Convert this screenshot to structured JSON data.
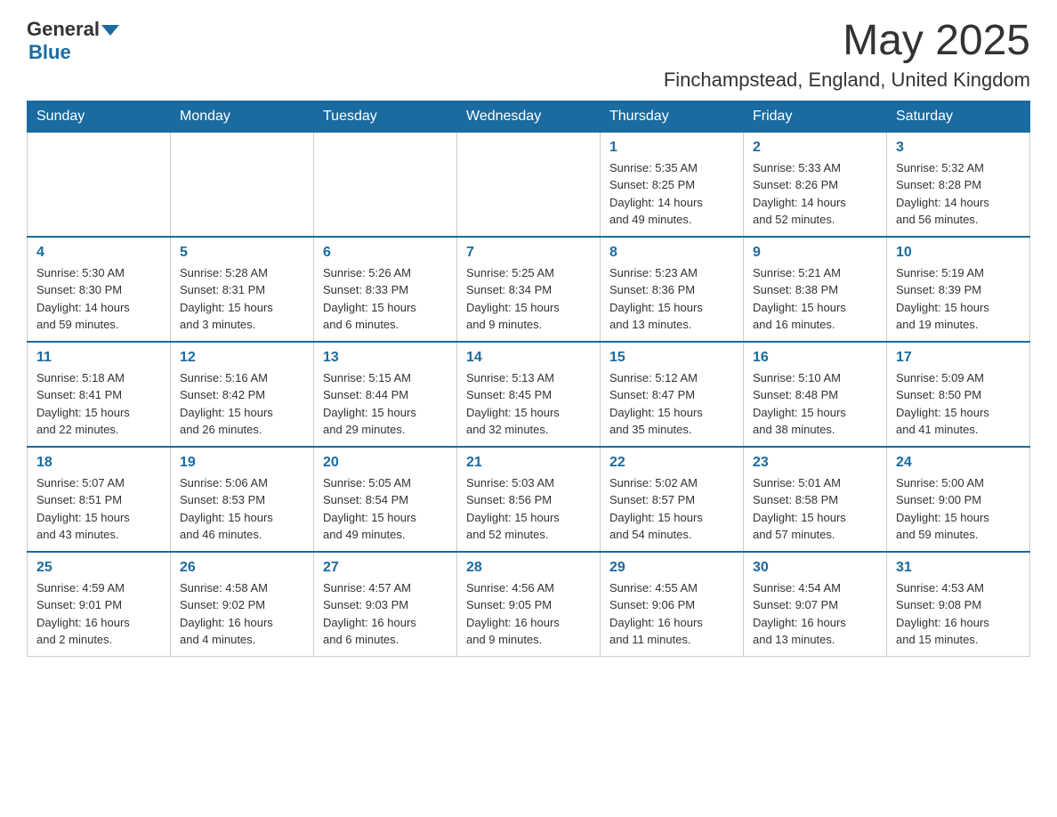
{
  "header": {
    "logo_general": "General",
    "logo_blue": "Blue",
    "month_title": "May 2025",
    "location": "Finchampstead, England, United Kingdom"
  },
  "days_of_week": [
    "Sunday",
    "Monday",
    "Tuesday",
    "Wednesday",
    "Thursday",
    "Friday",
    "Saturday"
  ],
  "weeks": [
    {
      "days": [
        {
          "num": "",
          "info": ""
        },
        {
          "num": "",
          "info": ""
        },
        {
          "num": "",
          "info": ""
        },
        {
          "num": "",
          "info": ""
        },
        {
          "num": "1",
          "info": "Sunrise: 5:35 AM\nSunset: 8:25 PM\nDaylight: 14 hours\nand 49 minutes."
        },
        {
          "num": "2",
          "info": "Sunrise: 5:33 AM\nSunset: 8:26 PM\nDaylight: 14 hours\nand 52 minutes."
        },
        {
          "num": "3",
          "info": "Sunrise: 5:32 AM\nSunset: 8:28 PM\nDaylight: 14 hours\nand 56 minutes."
        }
      ]
    },
    {
      "days": [
        {
          "num": "4",
          "info": "Sunrise: 5:30 AM\nSunset: 8:30 PM\nDaylight: 14 hours\nand 59 minutes."
        },
        {
          "num": "5",
          "info": "Sunrise: 5:28 AM\nSunset: 8:31 PM\nDaylight: 15 hours\nand 3 minutes."
        },
        {
          "num": "6",
          "info": "Sunrise: 5:26 AM\nSunset: 8:33 PM\nDaylight: 15 hours\nand 6 minutes."
        },
        {
          "num": "7",
          "info": "Sunrise: 5:25 AM\nSunset: 8:34 PM\nDaylight: 15 hours\nand 9 minutes."
        },
        {
          "num": "8",
          "info": "Sunrise: 5:23 AM\nSunset: 8:36 PM\nDaylight: 15 hours\nand 13 minutes."
        },
        {
          "num": "9",
          "info": "Sunrise: 5:21 AM\nSunset: 8:38 PM\nDaylight: 15 hours\nand 16 minutes."
        },
        {
          "num": "10",
          "info": "Sunrise: 5:19 AM\nSunset: 8:39 PM\nDaylight: 15 hours\nand 19 minutes."
        }
      ]
    },
    {
      "days": [
        {
          "num": "11",
          "info": "Sunrise: 5:18 AM\nSunset: 8:41 PM\nDaylight: 15 hours\nand 22 minutes."
        },
        {
          "num": "12",
          "info": "Sunrise: 5:16 AM\nSunset: 8:42 PM\nDaylight: 15 hours\nand 26 minutes."
        },
        {
          "num": "13",
          "info": "Sunrise: 5:15 AM\nSunset: 8:44 PM\nDaylight: 15 hours\nand 29 minutes."
        },
        {
          "num": "14",
          "info": "Sunrise: 5:13 AM\nSunset: 8:45 PM\nDaylight: 15 hours\nand 32 minutes."
        },
        {
          "num": "15",
          "info": "Sunrise: 5:12 AM\nSunset: 8:47 PM\nDaylight: 15 hours\nand 35 minutes."
        },
        {
          "num": "16",
          "info": "Sunrise: 5:10 AM\nSunset: 8:48 PM\nDaylight: 15 hours\nand 38 minutes."
        },
        {
          "num": "17",
          "info": "Sunrise: 5:09 AM\nSunset: 8:50 PM\nDaylight: 15 hours\nand 41 minutes."
        }
      ]
    },
    {
      "days": [
        {
          "num": "18",
          "info": "Sunrise: 5:07 AM\nSunset: 8:51 PM\nDaylight: 15 hours\nand 43 minutes."
        },
        {
          "num": "19",
          "info": "Sunrise: 5:06 AM\nSunset: 8:53 PM\nDaylight: 15 hours\nand 46 minutes."
        },
        {
          "num": "20",
          "info": "Sunrise: 5:05 AM\nSunset: 8:54 PM\nDaylight: 15 hours\nand 49 minutes."
        },
        {
          "num": "21",
          "info": "Sunrise: 5:03 AM\nSunset: 8:56 PM\nDaylight: 15 hours\nand 52 minutes."
        },
        {
          "num": "22",
          "info": "Sunrise: 5:02 AM\nSunset: 8:57 PM\nDaylight: 15 hours\nand 54 minutes."
        },
        {
          "num": "23",
          "info": "Sunrise: 5:01 AM\nSunset: 8:58 PM\nDaylight: 15 hours\nand 57 minutes."
        },
        {
          "num": "24",
          "info": "Sunrise: 5:00 AM\nSunset: 9:00 PM\nDaylight: 15 hours\nand 59 minutes."
        }
      ]
    },
    {
      "days": [
        {
          "num": "25",
          "info": "Sunrise: 4:59 AM\nSunset: 9:01 PM\nDaylight: 16 hours\nand 2 minutes."
        },
        {
          "num": "26",
          "info": "Sunrise: 4:58 AM\nSunset: 9:02 PM\nDaylight: 16 hours\nand 4 minutes."
        },
        {
          "num": "27",
          "info": "Sunrise: 4:57 AM\nSunset: 9:03 PM\nDaylight: 16 hours\nand 6 minutes."
        },
        {
          "num": "28",
          "info": "Sunrise: 4:56 AM\nSunset: 9:05 PM\nDaylight: 16 hours\nand 9 minutes."
        },
        {
          "num": "29",
          "info": "Sunrise: 4:55 AM\nSunset: 9:06 PM\nDaylight: 16 hours\nand 11 minutes."
        },
        {
          "num": "30",
          "info": "Sunrise: 4:54 AM\nSunset: 9:07 PM\nDaylight: 16 hours\nand 13 minutes."
        },
        {
          "num": "31",
          "info": "Sunrise: 4:53 AM\nSunset: 9:08 PM\nDaylight: 16 hours\nand 15 minutes."
        }
      ]
    }
  ]
}
